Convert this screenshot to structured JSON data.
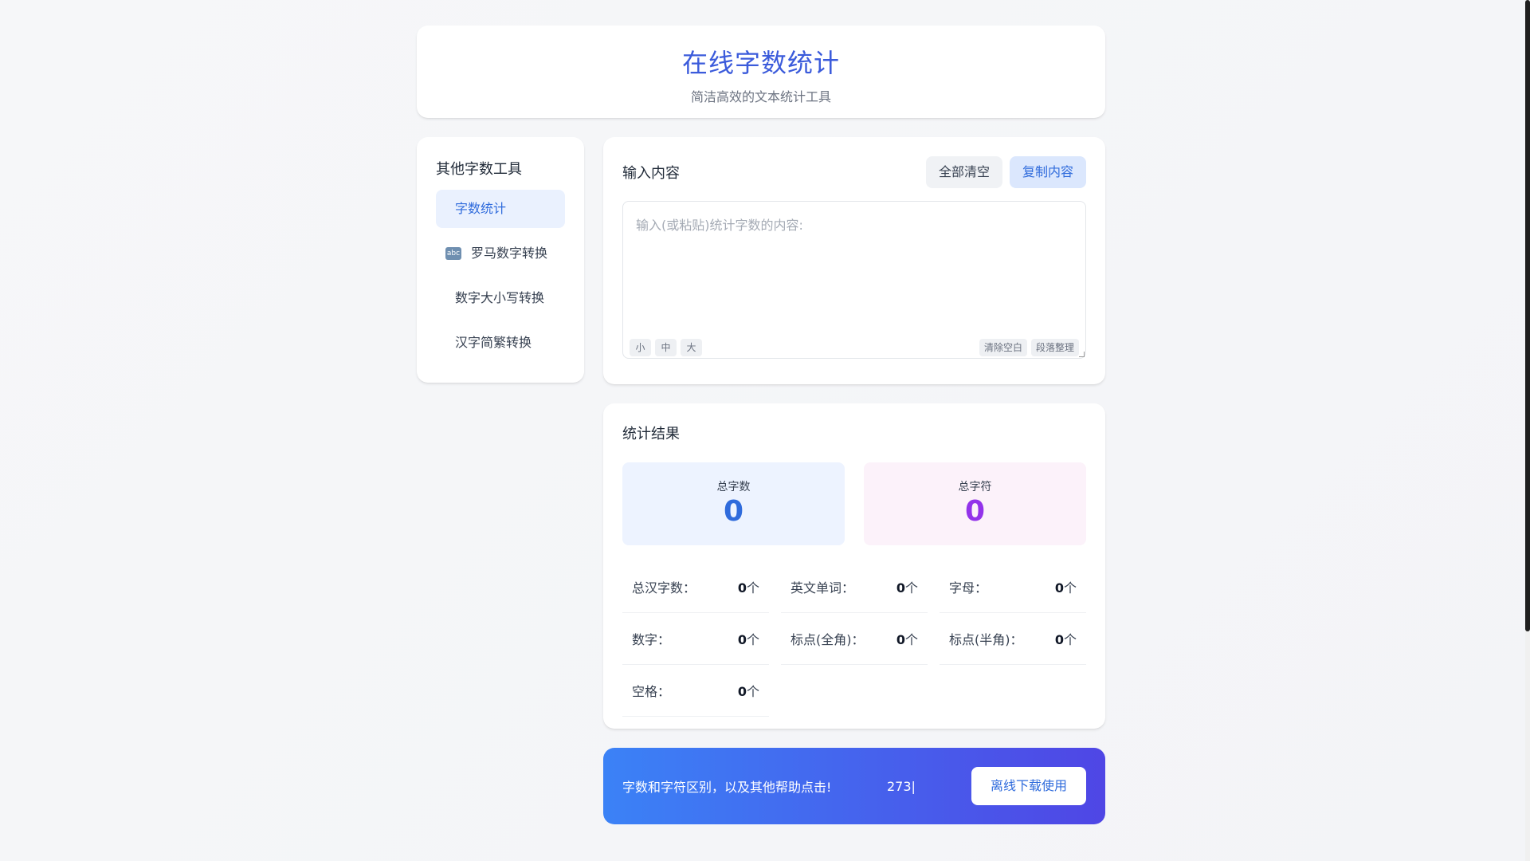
{
  "header": {
    "title": "在线字数统计",
    "subtitle": "简洁高效的文本统计工具"
  },
  "sidebar": {
    "title": "其他字数工具",
    "items": [
      {
        "label": "字数统计",
        "active": true
      },
      {
        "label": "罗马数字转换",
        "icon": "abc-icon",
        "icon_text": "abc"
      },
      {
        "label": "数字大小写转换"
      },
      {
        "label": "汉字简繁转换"
      }
    ]
  },
  "input": {
    "title": "输入内容",
    "clear_label": "全部清空",
    "copy_label": "复制内容",
    "placeholder": "输入(或粘贴)统计字数的内容:",
    "size_small": "小",
    "size_medium": "中",
    "size_large": "大",
    "trim_label": "清除空白",
    "paragraph_label": "段落整理"
  },
  "stats": {
    "title": "统计结果",
    "total_words_label": "总字数",
    "total_words": "0",
    "total_chars_label": "总字符",
    "total_chars": "0",
    "unit": "个",
    "items": [
      {
        "label": "总汉字数：",
        "value": "0"
      },
      {
        "label": "英文单词：",
        "value": "0"
      },
      {
        "label": "字母：",
        "value": "0"
      },
      {
        "label": "数字：",
        "value": "0"
      },
      {
        "label": "标点(全角)：",
        "value": "0"
      },
      {
        "label": "标点(半角)：",
        "value": "0"
      },
      {
        "label": "空格：",
        "value": "0"
      }
    ]
  },
  "banner": {
    "help_text": "字数和字符区别，以及其他帮助点击!",
    "counter": "273|",
    "download_label": "离线下载使用"
  },
  "colors": {
    "accent": "#2f6bdc",
    "purple": "#9333ea",
    "banner_start": "#3b82f6",
    "banner_end": "#4f46e5"
  }
}
